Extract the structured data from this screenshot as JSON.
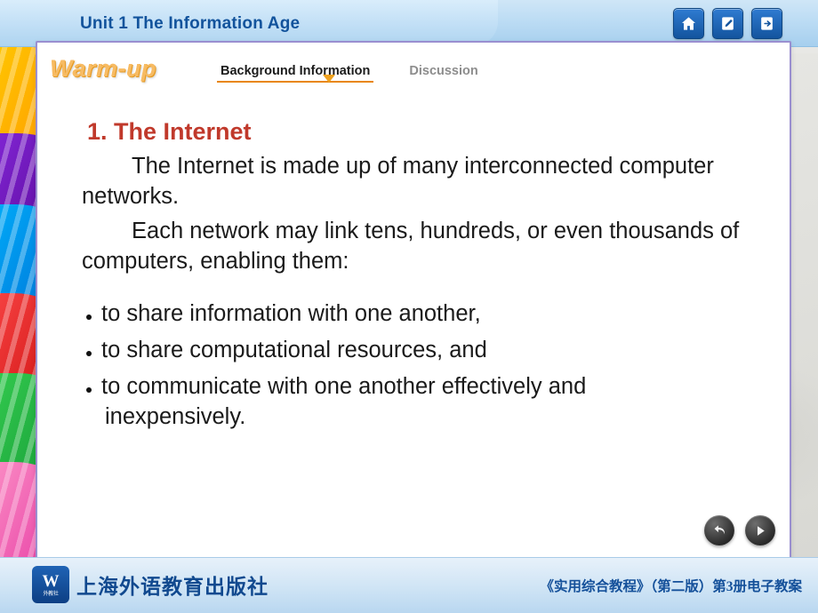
{
  "header": {
    "unit_title": "Unit 1 The Information Age",
    "nav_buttons": [
      {
        "name": "home-icon",
        "label": "Home"
      },
      {
        "name": "notes-icon",
        "label": "Notes"
      },
      {
        "name": "exit-icon",
        "label": "Exit"
      }
    ]
  },
  "slide": {
    "section_label": "Warm-up",
    "tabs": [
      {
        "label": "Background Information",
        "active": true
      },
      {
        "label": "Discussion",
        "active": false
      }
    ],
    "heading": "1. The Internet",
    "paragraphs": [
      "The Internet is made up of many interconnected computer networks.",
      "Each network may link tens, hundreds, or even thousands of computers, enabling them:"
    ],
    "bullets": [
      {
        "text": "to share information with one another,",
        "continuation": ""
      },
      {
        "text": "to share computational resources, and",
        "continuation": ""
      },
      {
        "text": "to communicate with one another effectively and",
        "continuation": "inexpensively."
      }
    ],
    "pager": [
      {
        "name": "previous-button",
        "glyph": "↩"
      },
      {
        "name": "next-button",
        "glyph": "▶"
      }
    ]
  },
  "footer": {
    "publisher_mark": "W",
    "publisher_mark_sub": "外教社",
    "publisher_cn": "上海外语教育出版社",
    "edition_text": "《实用综合教程》（第二版）第3册电子教案"
  },
  "colors": {
    "title_blue": "#12539c",
    "heading_red": "#c0392b",
    "tab_accent": "#e8870f",
    "warmup_gold": "#f7bb63",
    "panel_border": "#9a8fd0"
  }
}
